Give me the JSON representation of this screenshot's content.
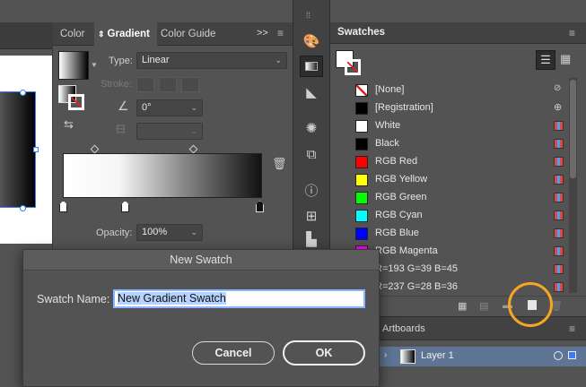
{
  "gradient_panel": {
    "tabs": [
      "Color",
      "Gradient",
      "Color Guide"
    ],
    "active_tab": "Gradient",
    "type_label": "Type:",
    "type_value": "Linear",
    "stroke_label": "Stroke:",
    "angle_value": "0°",
    "opacity_label": "Opacity:",
    "opacity_value": "100%",
    "overflow": ">>"
  },
  "swatches": {
    "title": "Swatches",
    "rows": [
      {
        "label": "[None]",
        "color": "none"
      },
      {
        "label": "[Registration]",
        "color": "#000000"
      },
      {
        "label": "White",
        "color": "#ffffff"
      },
      {
        "label": "Black",
        "color": "#000000"
      },
      {
        "label": "RGB Red",
        "color": "#ff0000"
      },
      {
        "label": "RGB Yellow",
        "color": "#ffff00"
      },
      {
        "label": "RGB Green",
        "color": "#00ff00"
      },
      {
        "label": "RGB Cyan",
        "color": "#00ffff"
      },
      {
        "label": "RGB Blue",
        "color": "#0000ff"
      },
      {
        "label": "RGB Magenta",
        "color": "#ff00ff"
      },
      {
        "label": "R=193 G=39 B=45",
        "color": "#c1272d"
      },
      {
        "label": "R=237 G=28 B=36",
        "color": "#ed1c24"
      }
    ]
  },
  "layers": {
    "tab": "Artboards",
    "layer_name": "Layer 1"
  },
  "dialog": {
    "title": "New Swatch",
    "field_label": "Swatch Name:",
    "field_value": "New Gradient Swatch",
    "cancel": "Cancel",
    "ok": "OK"
  },
  "highlight_color": "#f5a623"
}
